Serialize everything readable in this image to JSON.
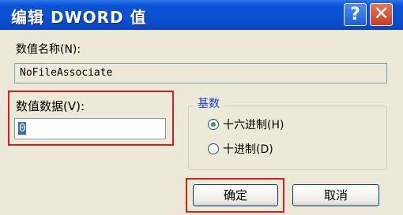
{
  "window": {
    "title": "编辑 DWORD 值",
    "help_glyph": "?",
    "close_glyph": "✕"
  },
  "value_name": {
    "label": "数值名称(N):",
    "value": "NoFileAssociate"
  },
  "value_data": {
    "label": "数值数据(V):",
    "value": "0"
  },
  "base": {
    "title": "基数",
    "options": [
      {
        "label": "十六进制(H)",
        "selected": true
      },
      {
        "label": "十进制(D)",
        "selected": false
      }
    ]
  },
  "buttons": {
    "ok": "确定",
    "cancel": "取消"
  },
  "colors": {
    "titlebar": "#0a53d6",
    "highlight_box": "#d42020",
    "group_title": "#1542c8",
    "dialog_bg": "#ece9d8"
  }
}
